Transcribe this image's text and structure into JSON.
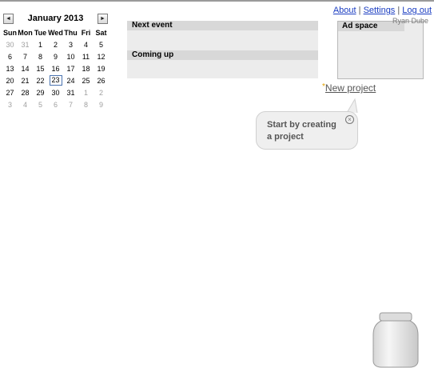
{
  "calendar": {
    "month_label": "January 2013",
    "prev_label": "◄",
    "next_label": "►",
    "weekdays": [
      "Sun",
      "Mon",
      "Tue",
      "Wed",
      "Thu",
      "Fri",
      "Sat"
    ],
    "weeks": [
      [
        {
          "d": "30",
          "o": true
        },
        {
          "d": "31",
          "o": true
        },
        {
          "d": "1"
        },
        {
          "d": "2"
        },
        {
          "d": "3"
        },
        {
          "d": "4"
        },
        {
          "d": "5"
        }
      ],
      [
        {
          "d": "6"
        },
        {
          "d": "7"
        },
        {
          "d": "8"
        },
        {
          "d": "9"
        },
        {
          "d": "10"
        },
        {
          "d": "11"
        },
        {
          "d": "12"
        }
      ],
      [
        {
          "d": "13"
        },
        {
          "d": "14"
        },
        {
          "d": "15"
        },
        {
          "d": "16"
        },
        {
          "d": "17"
        },
        {
          "d": "18"
        },
        {
          "d": "19"
        }
      ],
      [
        {
          "d": "20"
        },
        {
          "d": "21"
        },
        {
          "d": "22"
        },
        {
          "d": "23",
          "today": true
        },
        {
          "d": "24"
        },
        {
          "d": "25"
        },
        {
          "d": "26"
        }
      ],
      [
        {
          "d": "27"
        },
        {
          "d": "28"
        },
        {
          "d": "29"
        },
        {
          "d": "30"
        },
        {
          "d": "31"
        },
        {
          "d": "1",
          "o": true
        },
        {
          "d": "2",
          "o": true
        }
      ],
      [
        {
          "d": "3",
          "o": true
        },
        {
          "d": "4",
          "o": true
        },
        {
          "d": "5",
          "o": true
        },
        {
          "d": "6",
          "o": true
        },
        {
          "d": "7",
          "o": true
        },
        {
          "d": "8",
          "o": true
        },
        {
          "d": "9",
          "o": true
        }
      ]
    ]
  },
  "panels": {
    "next_event": "Next event",
    "coming_up": "Coming up"
  },
  "toplinks": {
    "about": "About",
    "settings": "Settings",
    "logout": "Log out",
    "sep": "|"
  },
  "user": {
    "name": "Ryan Dube"
  },
  "ad": {
    "title": "Ad space"
  },
  "new_project": {
    "star": "*",
    "label": "New project"
  },
  "tooltip": {
    "line1": "Start by creating",
    "line2": "a project",
    "close": "×"
  },
  "icons": {
    "jar": "jar-icon",
    "close": "close-icon"
  },
  "colors": {
    "link": "#1a3dc1",
    "panel": "#ececec",
    "panel_header": "#d8d8d8",
    "star": "#e0a000"
  }
}
